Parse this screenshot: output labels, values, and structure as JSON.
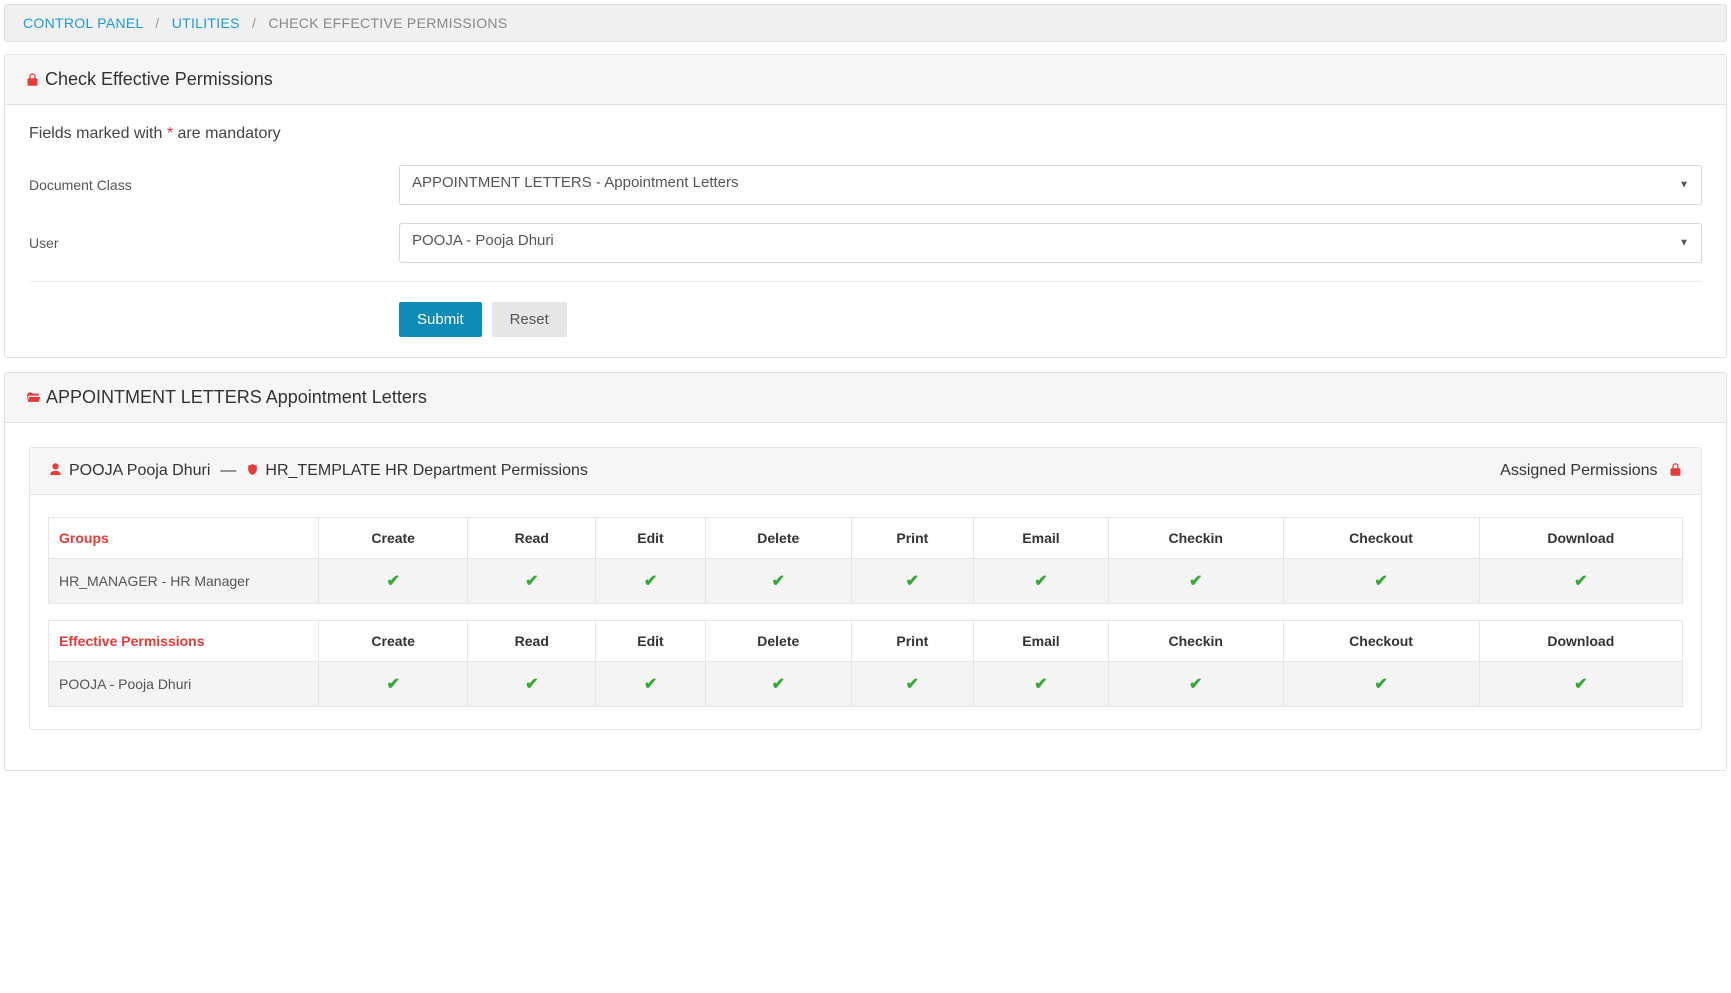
{
  "breadcrumb": {
    "control_panel": "CONTROL PANEL",
    "utilities": "UTILITIES",
    "current": "CHECK EFFECTIVE PERMISSIONS"
  },
  "panel1": {
    "title": "Check Effective Permissions",
    "help_prefix": "Fields marked with ",
    "help_star": "*",
    "help_suffix": " are mandatory",
    "doc_class_label": "Document Class",
    "doc_class_value": "APPOINTMENT LETTERS - Appointment Letters",
    "user_label": "User",
    "user_value": "POOJA - Pooja Dhuri",
    "submit": "Submit",
    "reset": "Reset"
  },
  "panel2": {
    "title": "APPOINTMENT LETTERS Appointment Letters",
    "user_text": "POOJA Pooja Dhuri",
    "template_text": "HR_TEMPLATE HR Department Permissions",
    "assigned": "Assigned Permissions",
    "columns": [
      "Create",
      "Read",
      "Edit",
      "Delete",
      "Print",
      "Email",
      "Checkin",
      "Checkout",
      "Download"
    ],
    "groups_label": "Groups",
    "groups_row": {
      "name": "HR_MANAGER - HR Manager",
      "perms": [
        true,
        true,
        true,
        true,
        true,
        true,
        true,
        true,
        true
      ]
    },
    "effective_label": "Effective Permissions",
    "effective_row": {
      "name": "POOJA - Pooja Dhuri",
      "perms": [
        true,
        true,
        true,
        true,
        true,
        true,
        true,
        true,
        true
      ]
    }
  }
}
